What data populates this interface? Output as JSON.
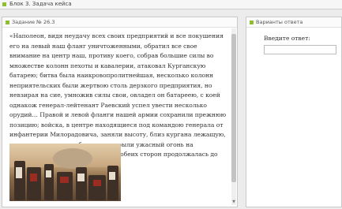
{
  "block": {
    "title": "Блок 3. Задача кейса"
  },
  "task": {
    "header": "Задание № 26.3",
    "text": "«Наполеон, видя неудачу всех своих предприятий и все покушения его на левый наш фланг уничтоженными, обратил все свое внимание на центр наш, противу коего, собрав большие силы во множестве колонн пехоты и кавалерии, атаковал Курганскую батарею; битва была наикровопролитнейшая, несколько колонн неприятельских были жертвою столь дерзкого предприятия, но невзирая на сие, умножив силы свои, овладел он батареею, с коей однакож генерал-лейтенант Раевский успел увести несколько орудий… Правой и левой фланги нашей армии сохранили прежнюю позицию; войска, в центре находящиеся под командою генерала от инфантерии Милорадовича, заняли высоту, близ кургана лежащую, где, поставя сильные батареи, открыли ужасный огонь на неприятеля. Жестокая канонада с обеих сторон продолжалась до глубокой ночи…»."
  },
  "answers": {
    "header": "Варианты ответа",
    "prompt": "Введите ответ:",
    "input_value": ""
  },
  "colors": {
    "accent": "#8fbf2e"
  }
}
